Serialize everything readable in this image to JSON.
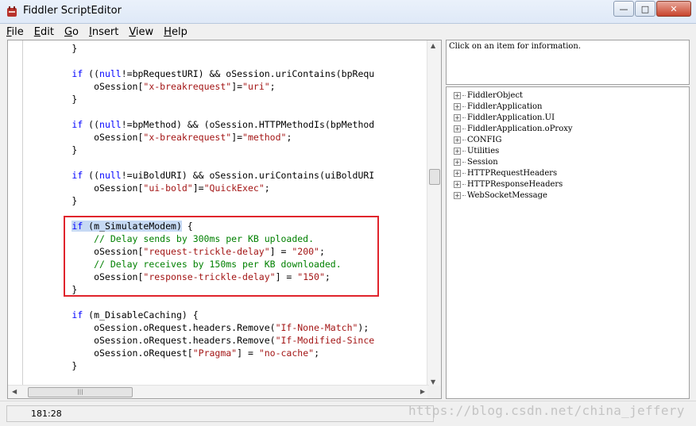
{
  "window": {
    "title": "Fiddler ScriptEditor"
  },
  "menu": {
    "items": [
      "File",
      "Edit",
      "Go",
      "Insert",
      "View",
      "Help"
    ]
  },
  "code": {
    "lines": [
      {
        "kind": "plain",
        "text": "        }"
      },
      {
        "kind": "blank",
        "text": ""
      },
      {
        "kind": "if",
        "kw": "if",
        "pre": " ((",
        "null": "null",
        "post": "!=bpRequestURI) && oSession.uriContains(bpRequ"
      },
      {
        "kind": "assign",
        "pre": "            oSession[",
        "str": "\"x-breakrequest\"",
        "mid": "]=",
        "val": "\"uri\"",
        "end": ";"
      },
      {
        "kind": "plain",
        "text": "        }"
      },
      {
        "kind": "blank",
        "text": ""
      },
      {
        "kind": "if",
        "kw": "if",
        "pre": " ((",
        "null": "null",
        "post": "!=bpMethod) && (oSession.HTTPMethodIs(bpMethod"
      },
      {
        "kind": "assign",
        "pre": "            oSession[",
        "str": "\"x-breakrequest\"",
        "mid": "]=",
        "val": "\"method\"",
        "end": ";"
      },
      {
        "kind": "plain",
        "text": "        }"
      },
      {
        "kind": "blank",
        "text": ""
      },
      {
        "kind": "if",
        "kw": "if",
        "pre": " ((",
        "null": "null",
        "post": "!=uiBoldURI) && oSession.uriContains(uiBoldURI"
      },
      {
        "kind": "assign",
        "pre": "            oSession[",
        "str": "\"ui-bold\"",
        "mid": "]=",
        "val": "\"QuickExec\"",
        "end": ";"
      },
      {
        "kind": "plain",
        "text": "        }"
      },
      {
        "kind": "blank",
        "text": ""
      },
      {
        "kind": "ifsel",
        "sel": "if (m_SimulateModem)",
        "post": " {"
      },
      {
        "kind": "comment",
        "text": "            // Delay sends by 300ms per KB uploaded."
      },
      {
        "kind": "assign",
        "pre": "            oSession[",
        "str": "\"request-trickle-delay\"",
        "mid": "] = ",
        "val": "\"200\"",
        "end": ";"
      },
      {
        "kind": "comment",
        "text": "            // Delay receives by 150ms per KB downloaded."
      },
      {
        "kind": "assign",
        "pre": "            oSession[",
        "str": "\"response-trickle-delay\"",
        "mid": "] = ",
        "val": "\"150\"",
        "end": ";"
      },
      {
        "kind": "plain",
        "text": "        }"
      },
      {
        "kind": "blank",
        "text": ""
      },
      {
        "kind": "ifplain",
        "kw": "if",
        "post": " (m_DisableCaching) {"
      },
      {
        "kind": "call",
        "pre": "            oSession.oRequest.headers.Remove(",
        "str": "\"If-None-Match\"",
        "end": ");"
      },
      {
        "kind": "call",
        "pre": "            oSession.oRequest.headers.Remove(",
        "str": "\"If-Modified-Since",
        "end": ""
      },
      {
        "kind": "assign",
        "pre": "            oSession.oRequest[",
        "str": "\"Pragma\"",
        "mid": "] = ",
        "val": "\"no-cache\"",
        "end": ";"
      },
      {
        "kind": "plain",
        "text": "        }"
      }
    ]
  },
  "info": {
    "text": "Click on an item for information."
  },
  "tree": {
    "items": [
      "FiddlerObject",
      "FiddlerApplication",
      "FiddlerApplication.UI",
      "FiddlerApplication.oProxy",
      "CONFIG",
      "Utilities",
      "Session",
      "HTTPRequestHeaders",
      "HTTPResponseHeaders",
      "WebSocketMessage"
    ]
  },
  "status": {
    "position": "181:28"
  },
  "watermark": {
    "text": "https://blog.csdn.net/china_jeffery"
  },
  "colors": {
    "keyword": "#0000ff",
    "string": "#a31515",
    "comment": "#008000",
    "highlight_box": "#e0242c"
  }
}
